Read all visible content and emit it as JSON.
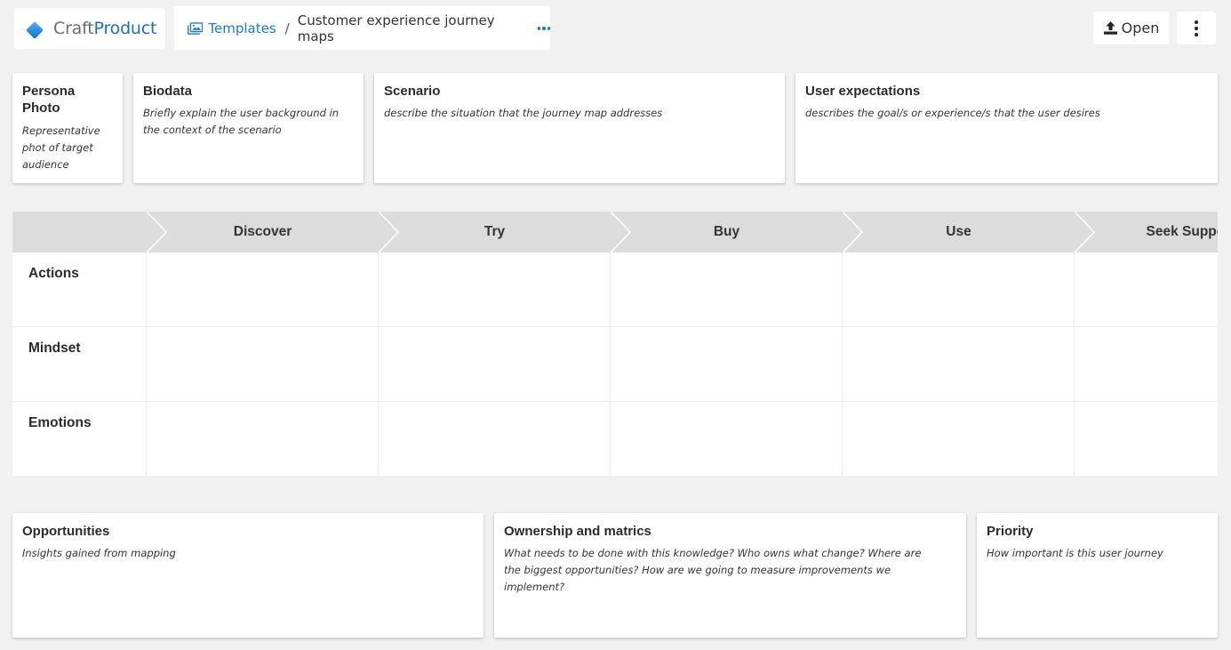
{
  "app": {
    "logo_craft": "Craft",
    "logo_product": "Product"
  },
  "breadcrumb": {
    "icon": "images-icon",
    "parent": "Templates",
    "separator": "/",
    "current": "Customer experience journey maps",
    "more_icon": "ellipsis-icon"
  },
  "toolbar": {
    "open_label": "Open",
    "open_icon": "upload-icon",
    "menu_icon": "vertical-ellipsis-icon"
  },
  "top_cards": [
    {
      "title": "Persona Photo",
      "desc": "Representative phot of target audience"
    },
    {
      "title": "Biodata",
      "desc": "Briefly explain the user background in the context of the scenario"
    },
    {
      "title": "Scenario",
      "desc": "describe the situation that the journey map addresses"
    },
    {
      "title": "User expectations",
      "desc": "describes the goal/s or experience/s that the user desires"
    }
  ],
  "journey": {
    "stages": [
      "Discover",
      "Try",
      "Buy",
      "Use",
      "Seek Support"
    ],
    "rows": [
      "Actions",
      "Mindset",
      "Emotions"
    ]
  },
  "bottom_cards": [
    {
      "title": "Opportunities",
      "desc": "Insights gained from mapping"
    },
    {
      "title": "Ownership and matrics",
      "desc": "What needs to be done with this knowledge? Who owns what change? Where are the biggest opportunities? How are we going to measure improvements we implement?"
    },
    {
      "title": "Priority",
      "desc": "How important is this user journey"
    }
  ],
  "colors": {
    "background": "#f1f1f1",
    "accent": "#1f78c8",
    "brand": "#1d6fb8",
    "header_gray": "#dcdcdc"
  }
}
